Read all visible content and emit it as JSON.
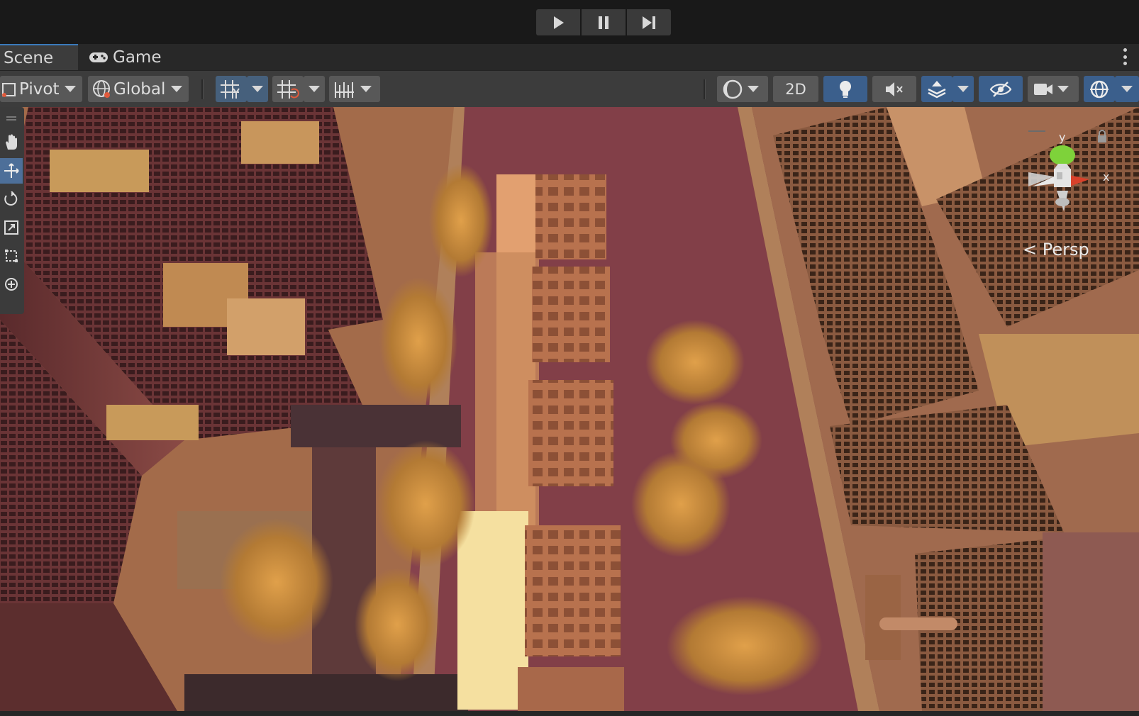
{
  "playbar": {
    "play": "play-icon",
    "pause": "pause-icon",
    "step": "step-forward-icon"
  },
  "tabs": [
    {
      "label": "Scene",
      "active": true
    },
    {
      "label": "Game",
      "icon": "gamepad-icon",
      "active": false
    }
  ],
  "toolbar": {
    "pivot_label": "Pivot",
    "global_label": "Global",
    "mode_2d": "2D"
  },
  "viewport": {
    "camera_label": "Persp",
    "gizmo_axes": {
      "y": "y",
      "x": "x"
    }
  },
  "colors": {
    "accent": "#3a79bb",
    "toolbar_active": "#46607c",
    "tool_selected": "#4d6f99",
    "gizmo_y": "#7ed23a",
    "gizmo_x": "#d8412b"
  }
}
